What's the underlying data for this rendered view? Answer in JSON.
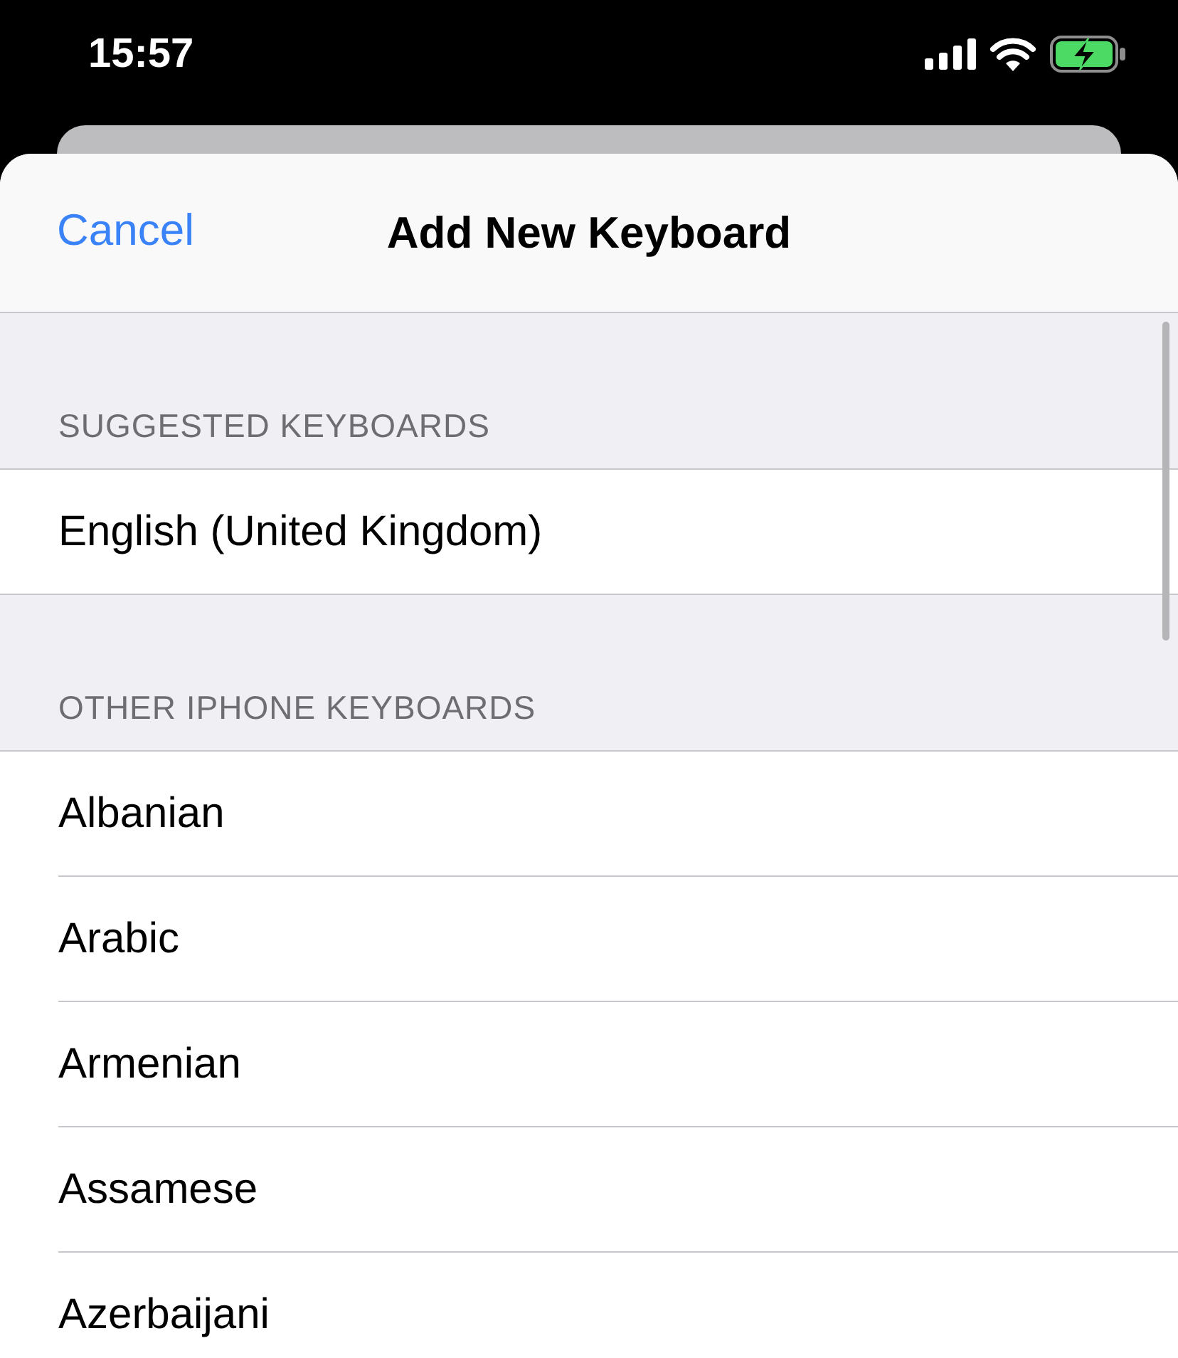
{
  "status_bar": {
    "time": "15:57"
  },
  "nav": {
    "cancel": "Cancel",
    "title": "Add New Keyboard"
  },
  "sections": [
    {
      "header": "SUGGESTED KEYBOARDS",
      "rows": [
        "English (United Kingdom)"
      ]
    },
    {
      "header": "OTHER IPHONE KEYBOARDS",
      "rows": [
        "Albanian",
        "Arabic",
        "Armenian",
        "Assamese",
        "Azerbaijani"
      ]
    }
  ]
}
